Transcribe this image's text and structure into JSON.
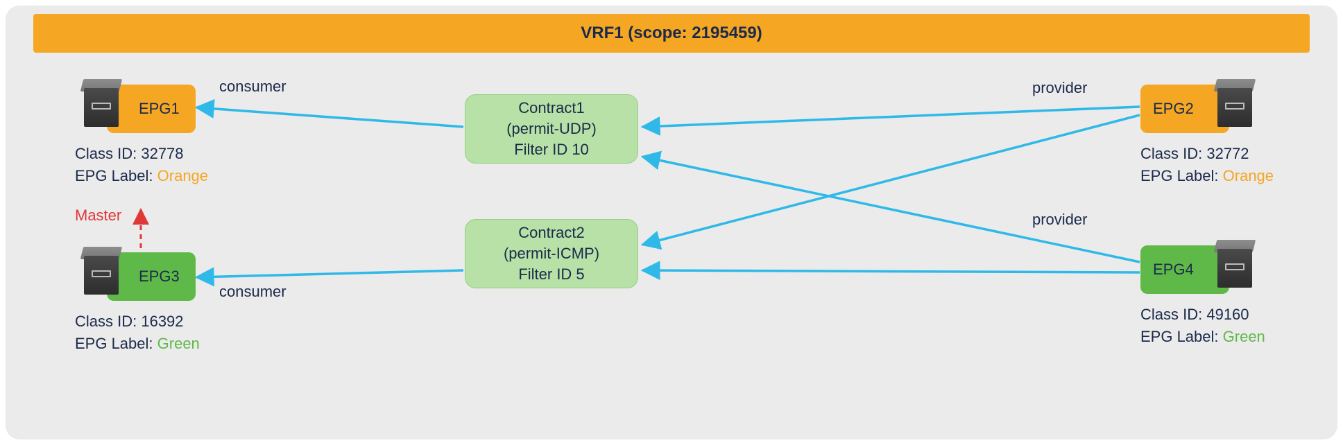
{
  "header": {
    "title": "VRF1 (scope: 2195459)"
  },
  "roles": {
    "consumer_top": "consumer",
    "consumer_bottom": "consumer",
    "provider_top": "provider",
    "provider_bottom": "provider"
  },
  "master_label": "Master",
  "contracts": {
    "c1": {
      "line1": "Contract1",
      "line2": "(permit-UDP)",
      "line3": "Filter ID 10"
    },
    "c2": {
      "line1": "Contract2",
      "line2": "(permit-ICMP)",
      "line3": "Filter ID 5"
    }
  },
  "epgs": {
    "epg1": {
      "name": "EPG1",
      "class_id_label": "Class ID: 32778",
      "epg_label_prefix": "EPG Label: ",
      "epg_label_value": "Orange",
      "color": "orange"
    },
    "epg2": {
      "name": "EPG2",
      "class_id_label": "Class ID: 32772",
      "epg_label_prefix": "EPG Label: ",
      "epg_label_value": "Orange",
      "color": "orange"
    },
    "epg3": {
      "name": "EPG3",
      "class_id_label": "Class ID: 16392",
      "epg_label_prefix": "EPG Label: ",
      "epg_label_value": "Green",
      "color": "green"
    },
    "epg4": {
      "name": "EPG4",
      "class_id_label": "Class ID: 49160",
      "epg_label_prefix": "EPG Label: ",
      "epg_label_value": "Green",
      "color": "green"
    }
  }
}
